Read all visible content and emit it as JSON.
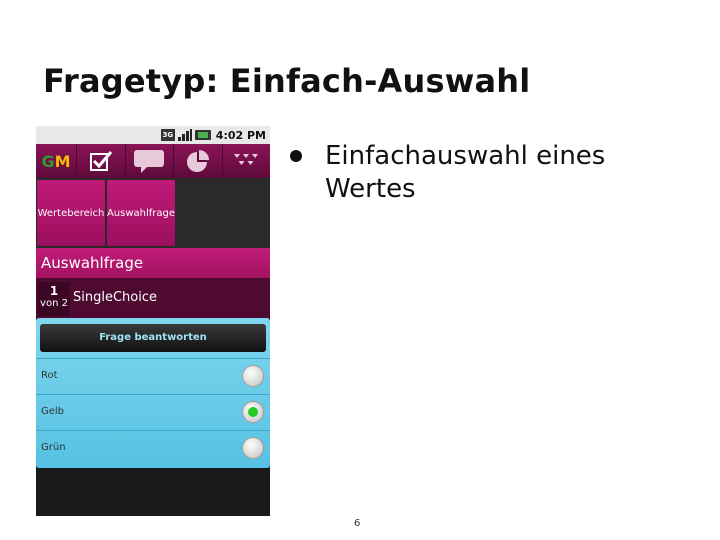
{
  "slide": {
    "title": "Fragetyp: Einfach-Auswahl",
    "bullet": "Einfachauswahl eines Wertes",
    "page_number": "6"
  },
  "phone": {
    "status_bar": {
      "network": "3G",
      "time": "4:02 PM"
    },
    "top_bar": {
      "logo_g": "G",
      "logo_m": "M",
      "icons": [
        "checkbox-icon",
        "chat-bubble-icon",
        "pie-chart-icon",
        "hearts-icon"
      ]
    },
    "tiles": [
      "Wertebereich",
      "Auswahlfrage"
    ],
    "header": "Auswahlfrage",
    "question": {
      "number": "1",
      "of": "von 2",
      "type": "SingleChoice"
    },
    "answer_button": "Frage beantworten",
    "options": [
      {
        "label": "Rot",
        "checked": false
      },
      {
        "label": "Gelb",
        "checked": true
      },
      {
        "label": "Grün",
        "checked": false
      }
    ],
    "colors": {
      "magenta": "#c01a78",
      "panel_blue": "#7fd6ee",
      "radio_green": "#22cc22"
    }
  }
}
